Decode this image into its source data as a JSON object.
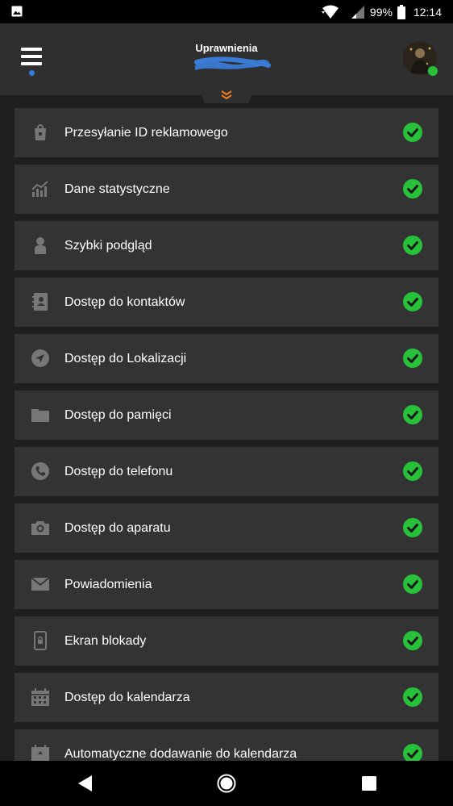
{
  "status_bar": {
    "battery_percent": "99%",
    "time": "12:14",
    "icons": [
      "image-icon",
      "wifi-icon",
      "signal-icon",
      "battery-icon"
    ]
  },
  "header": {
    "title": "Uprawnienia",
    "menu_icon": "hamburger-menu-icon",
    "pull_icon": "double-chevron-down-icon"
  },
  "colors": {
    "accent_orange": "#f07c1e",
    "check_green": "#27c23a",
    "row_bg": "#333333",
    "header_bg": "#2f2f2f"
  },
  "permissions": [
    {
      "label": "Przesyłanie ID reklamowego",
      "icon": "shopping-bag-icon",
      "granted": true
    },
    {
      "label": "Dane statystyczne",
      "icon": "chart-icon",
      "granted": true
    },
    {
      "label": "Szybki podgląd",
      "icon": "person-icon",
      "granted": true
    },
    {
      "label": "Dostęp do kontaktów",
      "icon": "contacts-book-icon",
      "granted": true
    },
    {
      "label": "Dostęp do Lokalizacji",
      "icon": "location-arrow-icon",
      "granted": true
    },
    {
      "label": "Dostęp do pamięci",
      "icon": "folder-icon",
      "granted": true
    },
    {
      "label": "Dostęp do telefonu",
      "icon": "phone-icon",
      "granted": true
    },
    {
      "label": "Dostęp do aparatu",
      "icon": "camera-icon",
      "granted": true
    },
    {
      "label": "Powiadomienia",
      "icon": "envelope-icon",
      "granted": true
    },
    {
      "label": "Ekran blokady",
      "icon": "phone-lock-icon",
      "granted": true
    },
    {
      "label": "Dostęp do kalendarza",
      "icon": "calendar-icon",
      "granted": true
    },
    {
      "label": "Automatyczne dodawanie do kalendarza",
      "icon": "calendar-add-icon",
      "granted": true
    }
  ]
}
